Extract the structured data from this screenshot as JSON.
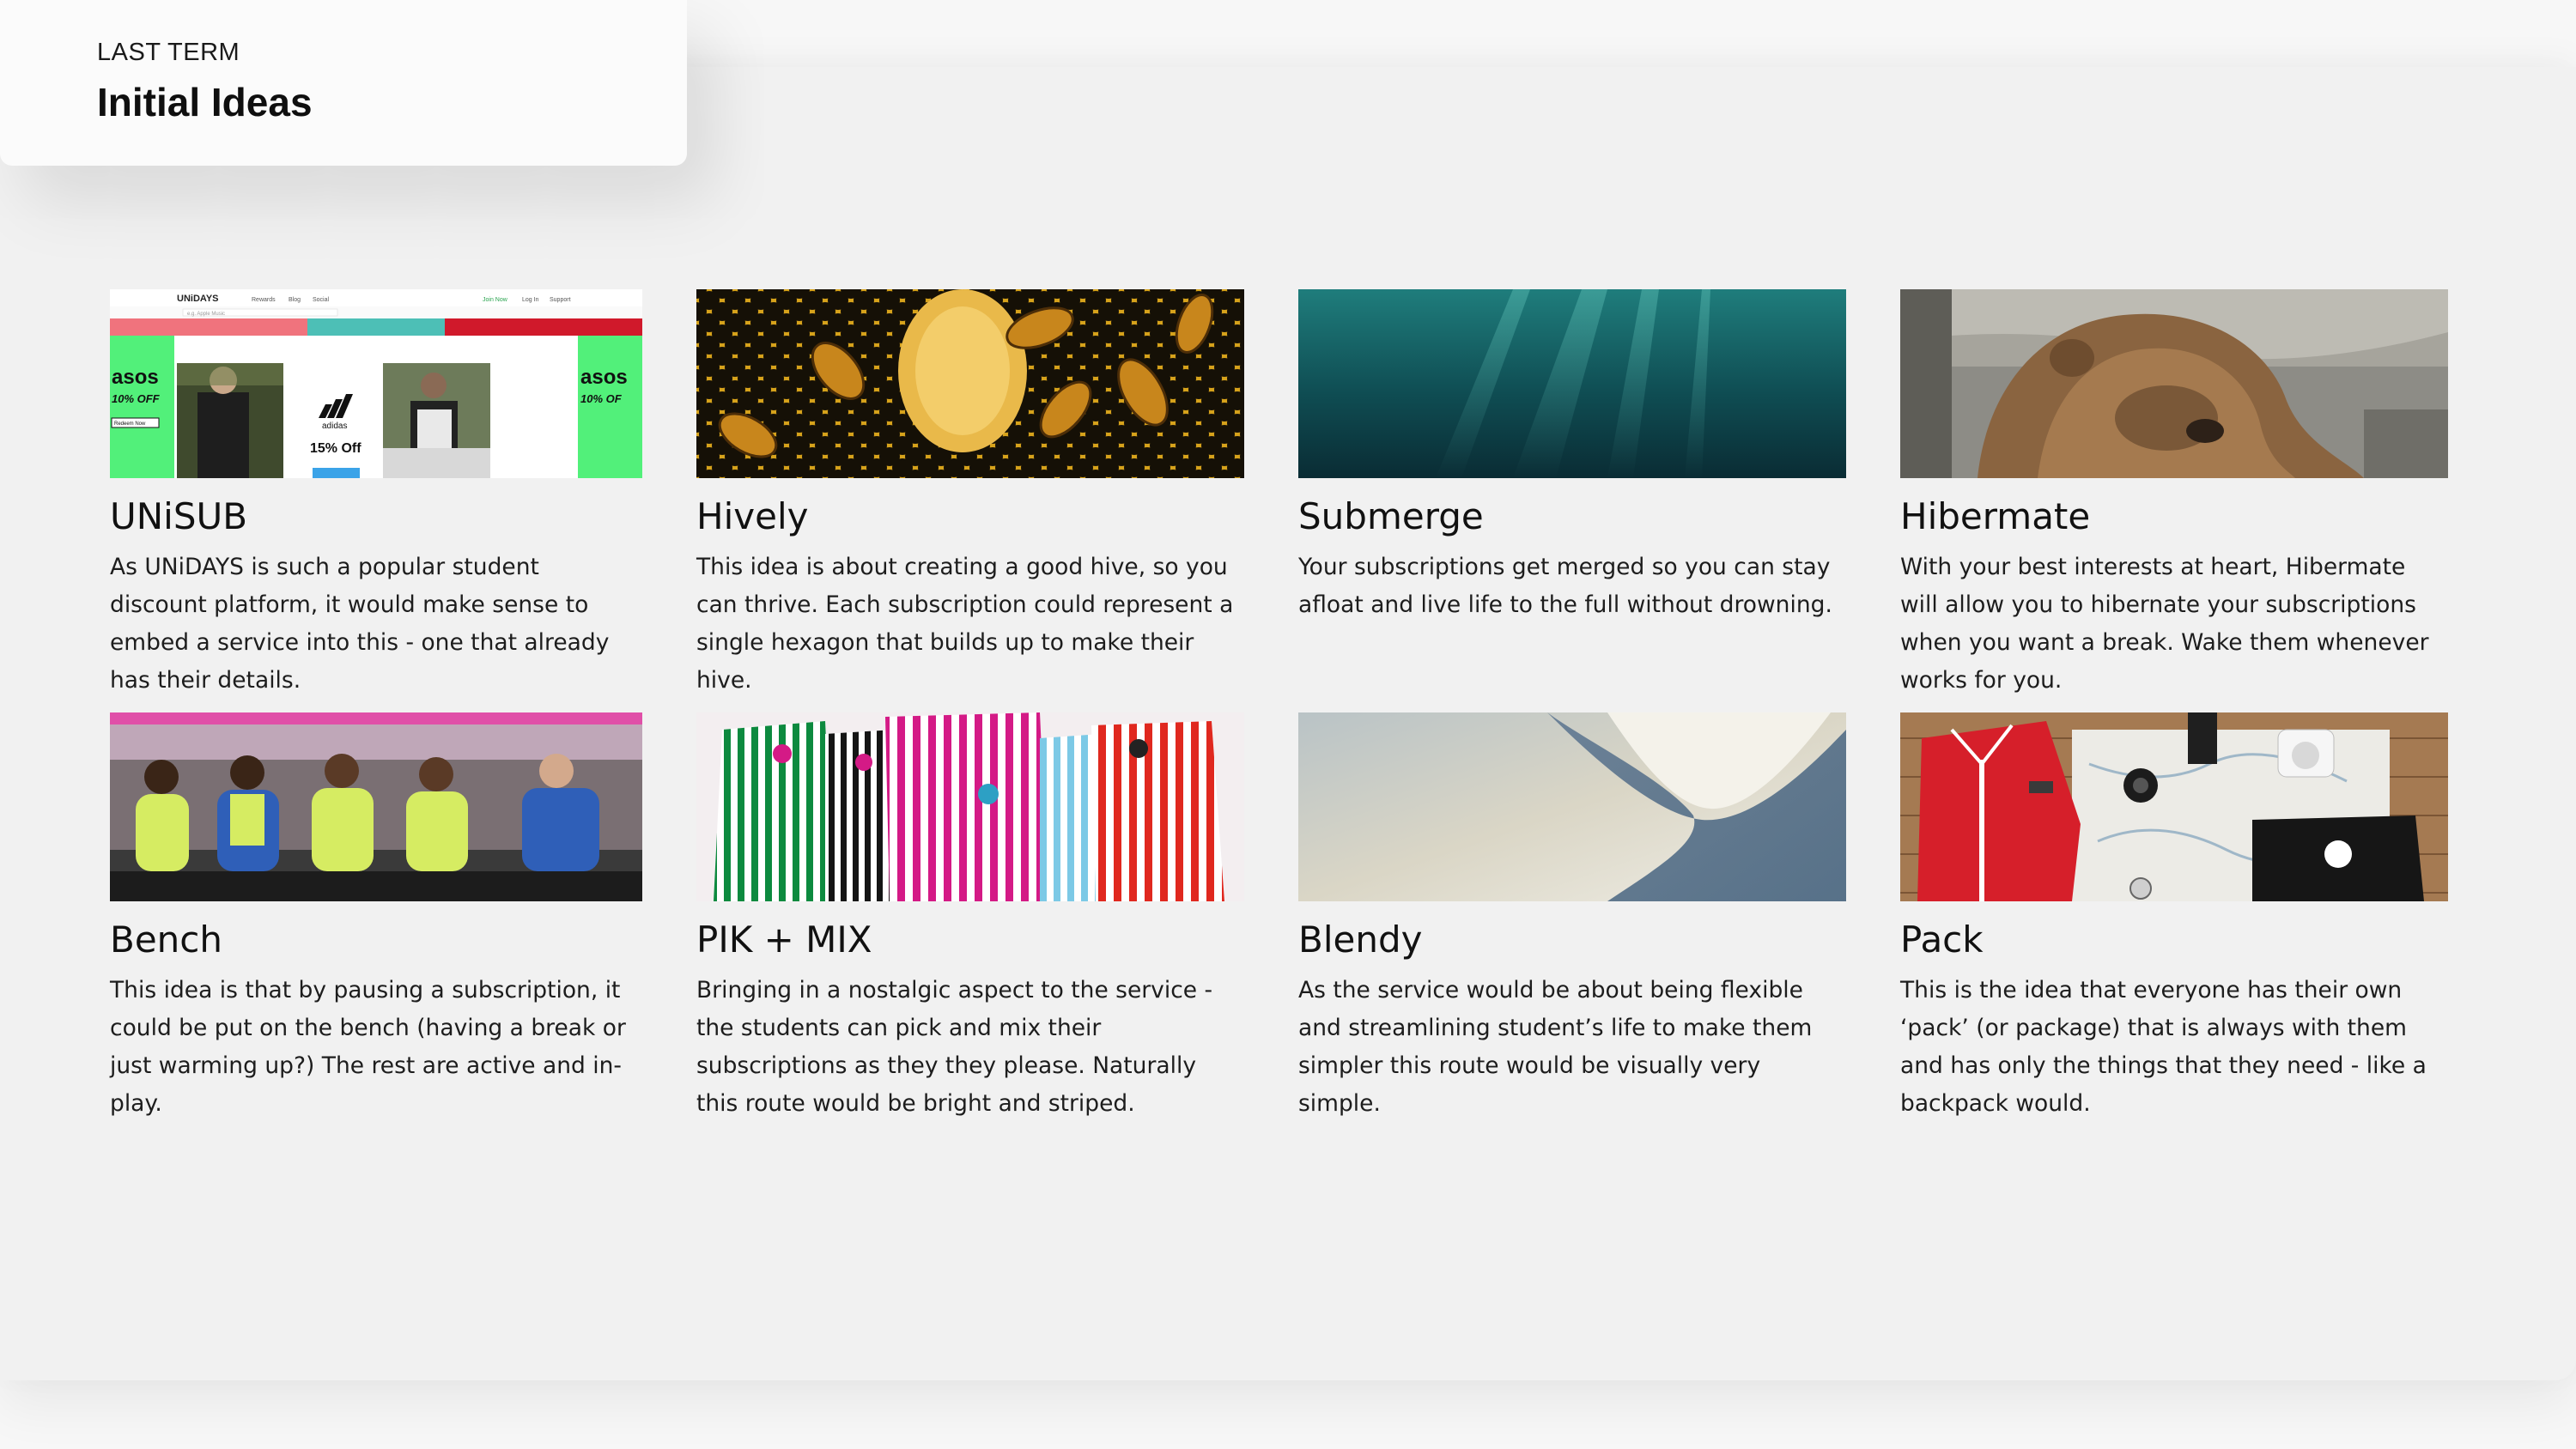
{
  "header": {
    "kicker": "LAST TERM",
    "title": "Initial Ideas"
  },
  "ideas": [
    {
      "title": "UNiSUB",
      "description": "As UNiDAYS is such a popular student discount platform, it would make sense to embed a service into this - one that already has their details.",
      "image": "unidays-website-screenshot",
      "image_text": {
        "logo": "UNiDAYS",
        "nav": [
          "Rewards",
          "Blog",
          "Social"
        ],
        "account": [
          "Join Now",
          "Log In",
          "Support"
        ],
        "search_placeholder": "e.g. Apple Music",
        "brand_left": "asos",
        "offer_left": "10% OFF",
        "brand_center": "adidas",
        "offer_center": "15% Off",
        "redeem_label": "Redeem Now"
      }
    },
    {
      "title": "Hively",
      "description": "This idea is about creating a good hive, so you can thrive. Each subscription could represent a single hexagon that builds up to make their hive.",
      "image": "honeycomb-bees-photo"
    },
    {
      "title": "Submerge",
      "description": "Your subscriptions get merged so you can stay afloat and live life to the full without drowning.",
      "image": "underwater-teal-photo"
    },
    {
      "title": "Hibermate",
      "description": "With your best interests at heart, Hibermate will allow you to hibernate your subscriptions when you want a break. Wake them whenever works for you.",
      "image": "sleeping-bear-photo"
    },
    {
      "title": "Bench",
      "description": "This idea is that by pausing a subscription, it could be put on the bench (having a break or just warming up?) The rest are active and in-play.",
      "image": "football-bench-photo"
    },
    {
      "title": "PIK + MIX",
      "description": "Bringing in a nostalgic aspect to the service - the students can pick and mix their subscriptions as they they please. Naturally this route would be bright and striped.",
      "image": "striped-sweet-bags-photo"
    },
    {
      "title": "Blendy",
      "description": "As the service would be about being flexible and streamlining student’s life to make them simpler this route would be visually very simple.",
      "image": "abstract-blend-photo"
    },
    {
      "title": "Pack",
      "description": "This is the idea that everyone has their own ‘pack’ (or package) that is always with them and has only the things that they need - like a backpack would.",
      "image": "packed-gear-flatlay-photo"
    }
  ],
  "colors": {
    "background": "#f1f1f1",
    "header_card": "#fbfbfb",
    "text": "#111111"
  }
}
